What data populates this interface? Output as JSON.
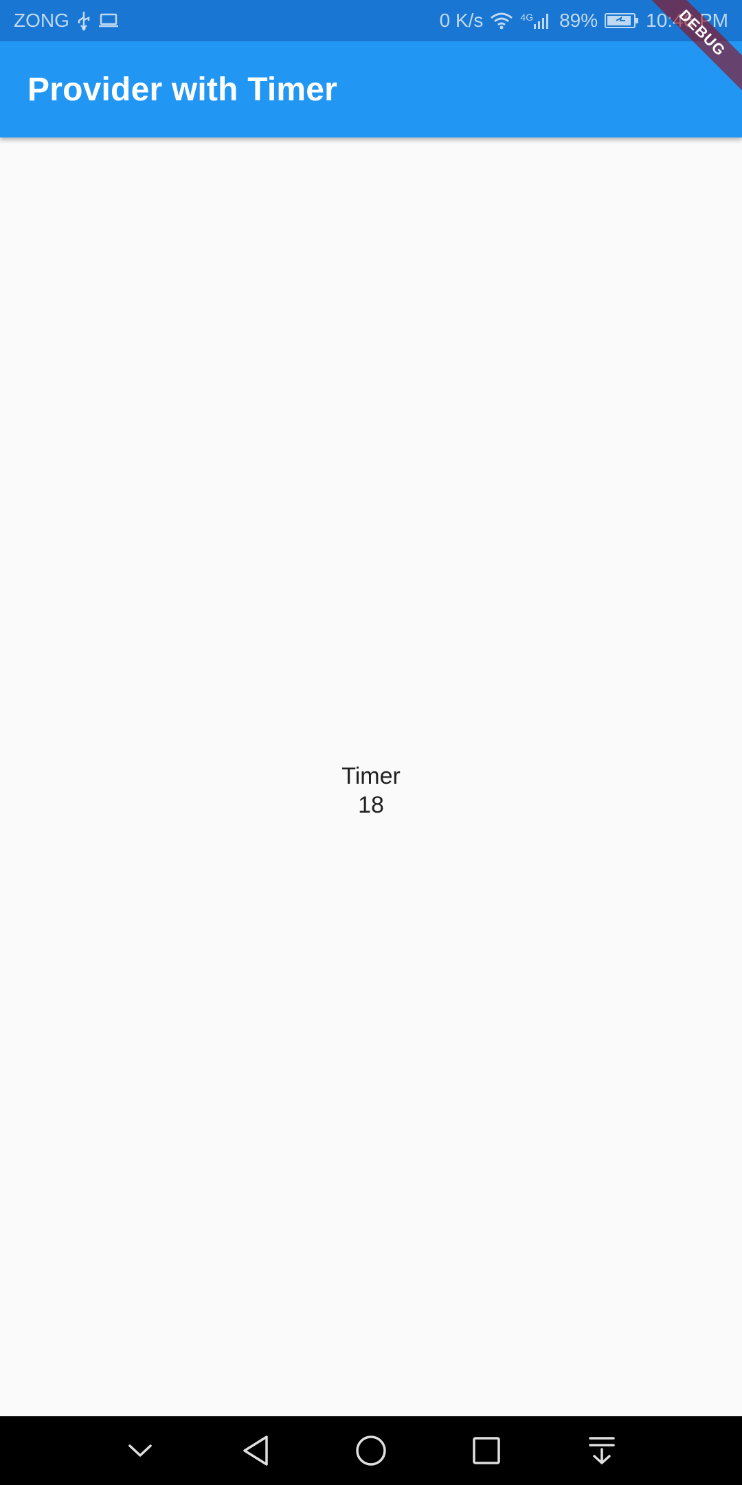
{
  "status_bar": {
    "carrier": "ZONG",
    "net_speed": "0 K/s",
    "network_type": "4G",
    "battery": "89%",
    "time": "10:46 PM",
    "background_color": "#1976d2",
    "icons": [
      "usb-icon",
      "laptop-icon",
      "wifi-icon",
      "signal-icon",
      "battery-icon"
    ]
  },
  "app_bar": {
    "title": "Provider with Timer",
    "background_color": "#2196f3"
  },
  "debug_banner": {
    "label": "DEBUG"
  },
  "main": {
    "timer_label": "Timer",
    "timer_value": "18"
  },
  "nav_bar": {
    "buttons": [
      "chevron-down-icon",
      "back-icon",
      "home-icon",
      "recents-icon",
      "notification-pull-icon"
    ]
  }
}
